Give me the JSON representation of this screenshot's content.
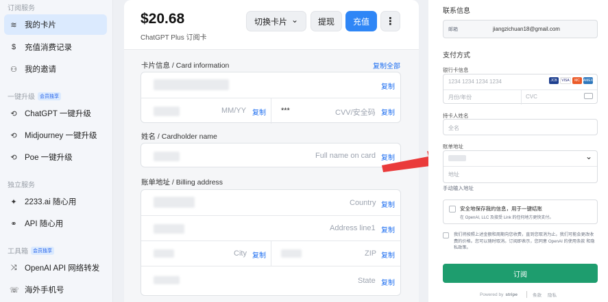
{
  "sidebar": {
    "sections": [
      {
        "title": "订阅服务"
      },
      {
        "title": "一键升级",
        "badge": "会员独享"
      },
      {
        "title": "独立服务"
      },
      {
        "title": "工具箱",
        "badge": "会员独享"
      }
    ],
    "items": [
      {
        "label": "我的卡片",
        "icon": "cash-stack-icon",
        "glyph": "≋",
        "active": true
      },
      {
        "label": "充值消费记录",
        "icon": "dollar-icon",
        "glyph": "$"
      },
      {
        "label": "我的邀请",
        "icon": "people-icon",
        "glyph": "⚇"
      },
      {
        "label": "ChatGPT 一键升级",
        "icon": "gpt-icon",
        "glyph": "⟲"
      },
      {
        "label": "Midjourney 一键升级",
        "icon": "gpt-icon",
        "glyph": "⟲"
      },
      {
        "label": "Poe 一键升级",
        "icon": "gpt-icon",
        "glyph": "⟲"
      },
      {
        "label": "2233.ai 随心用",
        "icon": "sparkle-icon",
        "glyph": "✦"
      },
      {
        "label": "API 随心用",
        "icon": "link-icon",
        "glyph": "⚭"
      },
      {
        "label": "OpenAI API 网络转发",
        "icon": "shuffle-icon",
        "glyph": "⤨"
      },
      {
        "label": "海外手机号",
        "icon": "phone-icon",
        "glyph": "☏"
      }
    ]
  },
  "card": {
    "amount": "$20.68",
    "plan": "ChatGPT Plus 订阅卡",
    "switch_label": "切换卡片",
    "withdraw_label": "提现",
    "topup_label": "充值",
    "more_glyph": "⋮",
    "chevron_glyph": "⌄"
  },
  "card_info": {
    "label": "卡片信息 / Card information",
    "copy_all": "复制全部",
    "copy": "复制",
    "mmyy": "MM/YY",
    "cvv_mask": "***",
    "cvv": "CVV/安全码"
  },
  "cardholder": {
    "label": "姓名 / Cardholder name",
    "placeholder": "Full name on card"
  },
  "billing": {
    "label": "账单地址 / Billing address",
    "country": "Country",
    "address": "Address line1",
    "city": "City",
    "zip": "ZIP",
    "state": "State"
  },
  "stripe": {
    "contact_title": "联系信息",
    "email_label": "邮箱",
    "email": "jiangzichuan18@gmail.com",
    "payment_title": "支付方式",
    "card_label": "银行卡信息",
    "card_placeholder": "1234 1234 1234 1234",
    "expiry_placeholder": "月份/年份",
    "cvc_placeholder": "CVC",
    "name_label": "持卡人姓名",
    "name_placeholder": "全名",
    "address_label": "账单地址",
    "address_placeholder": "地址",
    "manual_address": "手动输入地址",
    "save_title": "安全地保存我的信息，用于一键结账",
    "save_desc": "在 OpenAI, LLC 及接受 Link 的任何地方更快支付。",
    "terms": "我们将按照上述金额和周期向您收费，直到您取消为止。我们可能会更改收费的价格。您可以随时取消。订阅即表示，您同意 OpenAI 的使用条款 和隐私政策。",
    "subscribe": "订阅",
    "powered": "Powered by",
    "stripe_brand": "stripe",
    "terms_link": "条款",
    "privacy_link": "隐私",
    "brands": [
      "JCB",
      "VISA",
      "MC",
      "AMEX"
    ]
  }
}
